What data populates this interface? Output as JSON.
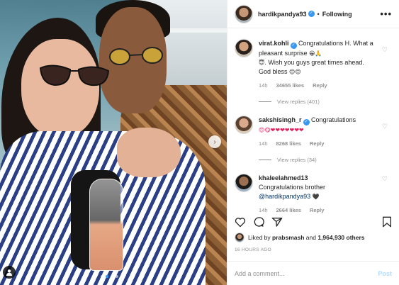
{
  "post": {
    "username": "hardikpandya93",
    "separator": "•",
    "follow_label": "Following",
    "more_label": "•••",
    "carousel_next": "›",
    "likes_prefix": "Liked by",
    "likes_user": "prabsmash",
    "likes_and": "and",
    "likes_count": "1,964,930 others",
    "time_ago": "16 HOURS AGO",
    "add_comment_placeholder": "Add a comment...",
    "post_label": "Post"
  },
  "comments": [
    {
      "user": "virat.kohli",
      "text": "Congratulations H. What a pleasant surprise",
      "emoji_a": "😀🙏",
      "emoji_b": "😇",
      "text2": ". Wish you guys great times ahead. God bless",
      "emoji_c": "😊😊",
      "time": "14h",
      "likes": "34655 likes",
      "reply": "Reply",
      "view_replies": "View replies (401)"
    },
    {
      "user": "sakshisingh_r",
      "text": "Congratulations",
      "emoji_a": "😊😋❤❤❤❤❤❤❤",
      "time": "14h",
      "likes": "8268 likes",
      "reply": "Reply",
      "view_replies": "View replies (34)"
    },
    {
      "user": "khaleelahmed13",
      "text": "Congratulations brother",
      "mention": "@hardikpandya93",
      "emoji_a": "🖤",
      "time": "14h",
      "likes": "2664 likes",
      "reply": "Reply"
    }
  ],
  "icons": {
    "verified": "✓",
    "heart": "♡"
  },
  "colors": {
    "link_blue": "#003569",
    "accent_blue": "#3897f0",
    "muted": "#8e8e8e"
  },
  "carousel": {
    "count": 4,
    "active_index": 1
  }
}
